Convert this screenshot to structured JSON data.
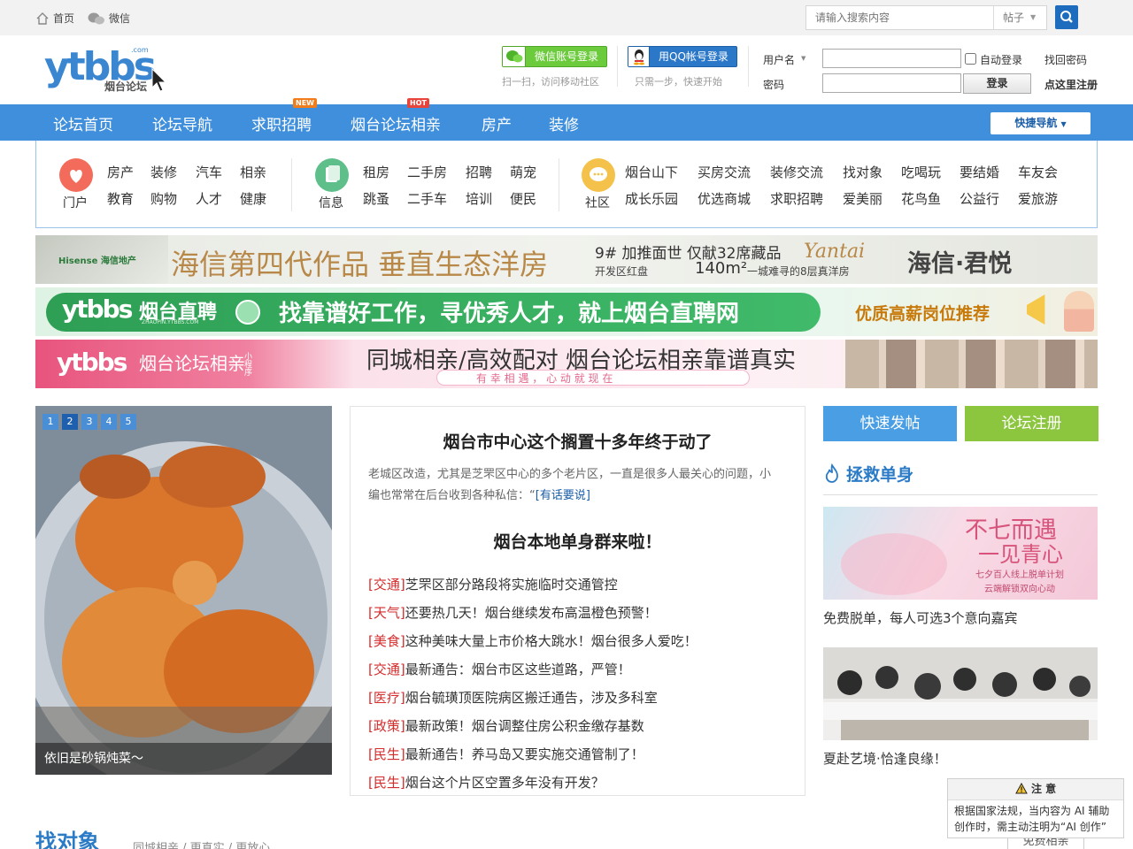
{
  "topbar": {
    "home": "首页",
    "wechat": "微信",
    "search_placeholder": "请输入搜索内容",
    "search_type": "帖子"
  },
  "header": {
    "logo_text": "ytbbs",
    "logo_sub": "烟台论坛",
    "logo_com": ".com",
    "wechat_login": "微信账号登录",
    "wechat_hint": "扫一扫，访问移动社区",
    "qq_login": "用QQ帐号登录",
    "qq_hint": "只需一步，快速开始",
    "username_label": "用户名",
    "password_label": "密码",
    "auto_login": "自动登录",
    "find_password": "找回密码",
    "register": "点这里注册",
    "login_button": "登录"
  },
  "nav": {
    "items": [
      "论坛首页",
      "论坛导航",
      "求职招聘",
      "烟台论坛相亲",
      "房产",
      "装修"
    ],
    "badge_new": "NEW",
    "badge_hot": "HOT",
    "quick_nav": "快捷导航"
  },
  "categories": {
    "group1": {
      "name": "门户",
      "links": [
        "房产",
        "装修",
        "汽车",
        "相亲",
        "教育",
        "购物",
        "人才",
        "健康"
      ]
    },
    "group2": {
      "name": "信息",
      "links": [
        "租房",
        "二手房",
        "招聘",
        "萌宠",
        "跳蚤",
        "二手车",
        "培训",
        "便民"
      ]
    },
    "group3": {
      "name": "社区",
      "links": [
        "烟台山下",
        "买房交流",
        "装修交流",
        "找对象",
        "吃喝玩",
        "要结婚",
        "车友会",
        "成长乐园",
        "优选商城",
        "求职招聘",
        "爱美丽",
        "花鸟鱼",
        "公益行",
        "爱旅游"
      ]
    }
  },
  "banners": {
    "b1": {
      "brand": "Hisense 海信地产",
      "main": "海信第四代作品  垂直生态洋房",
      "line1": "9# 加推面世 仅献32席藏品",
      "line2a": "开发区红盘",
      "line2b": "140m²",
      "line2c": "一城难寻的8层真洋房",
      "sign": "Yantai",
      "right": "海信·君悦"
    },
    "b2": {
      "logo": "ytbbs",
      "name": "烟台直聘",
      "sub": "ZHAOPIN.YTBBS.COM",
      "main": "找靠谱好工作，寻优秀人才，就上烟台直聘网",
      "right": "优质高薪岗位推荐"
    },
    "b3": {
      "logo": "ytbbs",
      "name": "烟台论坛相亲",
      "mini": "小程序",
      "main": "同城相亲/高效配对  烟台论坛相亲靠谱真实",
      "sub": "有 幸 相 遇 ， 心 动 就 现 在"
    }
  },
  "slideshow": {
    "pages": [
      "1",
      "2",
      "3",
      "4",
      "5"
    ],
    "active_page": 2,
    "caption": "依旧是砂锅炖菜～"
  },
  "news": {
    "headline1": "烟台市中心这个搁置十多年终于动了",
    "summary": "老城区改造，尤其是芝罘区中心的多个老片区，一直是很多人最关心的问题，小编也常常在后台收到各种私信：“",
    "summary_link": "[有话要说]",
    "headline2": "烟台本地单身群来啦！",
    "items": [
      {
        "tag": "[交通]",
        "title": "芝罘区部分路段将实施临时交通管控"
      },
      {
        "tag": "[天气]",
        "title": "还要热几天！烟台继续发布高温橙色预警！"
      },
      {
        "tag": "[美食]",
        "title": "这种美味大量上市价格大跳水！烟台很多人爱吃！"
      },
      {
        "tag": "[交通]",
        "title": "最新通告：烟台市区这些道路，严管！"
      },
      {
        "tag": "[医疗]",
        "title": "烟台毓璜顶医院病区搬迁通告，涉及多科室"
      },
      {
        "tag": "[政策]",
        "title": "最新政策！烟台调整住房公积金缴存基数"
      },
      {
        "tag": "[民生]",
        "title": "最新通告！养马岛又要实施交通管制了！"
      },
      {
        "tag": "[民生]",
        "title": "烟台这个片区空置多年没有开发？"
      }
    ]
  },
  "sidebar": {
    "quick_post": "快速发帖",
    "register": "论坛注册",
    "rescue_title": "拯救单身",
    "card1_title_a": "不七而遇",
    "card1_title_b": "一见青心",
    "card1_sub_a": "七夕百人线上脱单计划",
    "card1_sub_b": "云端解锁双向心动",
    "card1_caption": "免费脱单，每人可选3个意向嘉宾",
    "card2_caption": "夏赴艺境·恰逢良缘！"
  },
  "bottom": {
    "find_title": "找对象",
    "find_sub": "同城相亲 / 更真实 / 更放心",
    "more_button": "免费相亲"
  },
  "notice": {
    "title": "注 意",
    "body": "根据国家法规，当内容为 AI 辅助创作时，需主动注明为“AI 创作”"
  },
  "colors": {
    "nav_blue": "#3f8fdc",
    "tag_red": "#d62b2b",
    "link_blue": "#1b5ea8",
    "quick_post": "#4a9ee3",
    "register": "#8cc63f"
  }
}
